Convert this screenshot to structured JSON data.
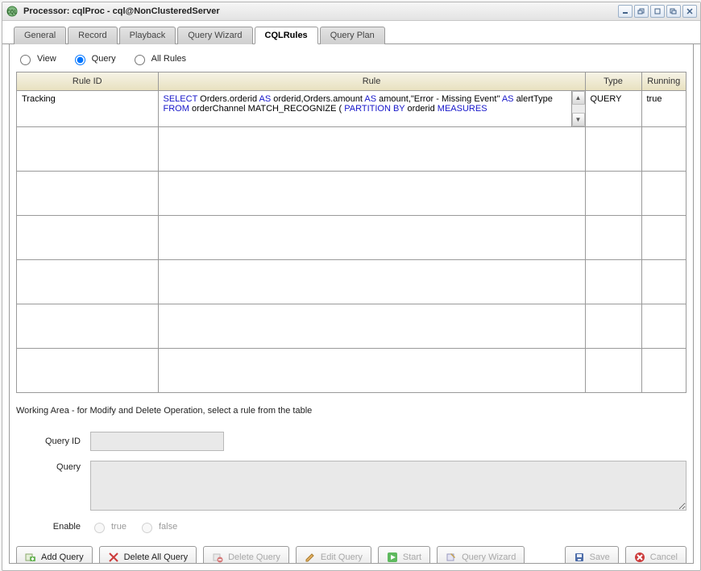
{
  "window": {
    "title": "Processor: cqlProc - cql@NonClusteredServer"
  },
  "tabs": [
    {
      "label": "General"
    },
    {
      "label": "Record"
    },
    {
      "label": "Playback"
    },
    {
      "label": "Query Wizard"
    },
    {
      "label": "CQLRules"
    },
    {
      "label": "Query Plan"
    }
  ],
  "active_tab": 4,
  "filter": {
    "options": [
      "View",
      "Query",
      "All Rules"
    ],
    "selected": 1
  },
  "table": {
    "headers": [
      "Rule ID",
      "Rule",
      "Type",
      "Running"
    ],
    "rows": [
      {
        "rule_id": "Tracking",
        "rule_html_parts": [
          {
            "t": "kw",
            "v": "SELECT "
          },
          {
            "t": "tx",
            "v": "Orders.orderid "
          },
          {
            "t": "kw",
            "v": "AS "
          },
          {
            "t": "tx",
            "v": "orderid,Orders.amount "
          },
          {
            "t": "kw",
            "v": "AS "
          },
          {
            "t": "tx",
            "v": "amount,\"Error - Missing Event\" "
          },
          {
            "t": "kw",
            "v": "AS "
          },
          {
            "t": "tx",
            "v": "alertType "
          },
          {
            "t": "kw",
            "v": "FROM "
          },
          {
            "t": "tx",
            "v": "orderChannel MATCH_RECOGNIZE ( "
          },
          {
            "t": "kw",
            "v": "PARTITION BY "
          },
          {
            "t": "tx",
            "v": "orderid "
          },
          {
            "t": "kw",
            "v": "MEASURES"
          }
        ],
        "type": "QUERY",
        "running": "true"
      }
    ]
  },
  "working_area": {
    "hint": "Working Area - for Modify and Delete Operation, select a rule from the table",
    "labels": {
      "query_id": "Query ID",
      "query": "Query",
      "enable": "Enable",
      "enable_true": "true",
      "enable_false": "false"
    }
  },
  "toolbar": {
    "add_query": "Add Query",
    "delete_all": "Delete All Query",
    "delete_query": "Delete Query",
    "edit_query": "Edit Query",
    "start": "Start",
    "query_wizard": "Query Wizard",
    "save": "Save",
    "cancel": "Cancel"
  }
}
